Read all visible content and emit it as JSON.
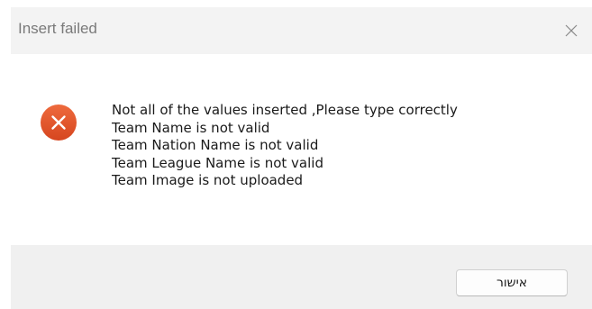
{
  "window": {
    "title": "Insert failed",
    "close_icon": "close-icon"
  },
  "message": {
    "icon": "error-icon",
    "icon_color": "#e0532c",
    "lines": [
      "Not all of the values inserted ,Please type correctly",
      "Team Name is not valid",
      "Team Nation Name is not valid",
      "Team League Name is not valid",
      "Team Image is not uploaded"
    ]
  },
  "footer": {
    "ok_label": "אישור"
  }
}
